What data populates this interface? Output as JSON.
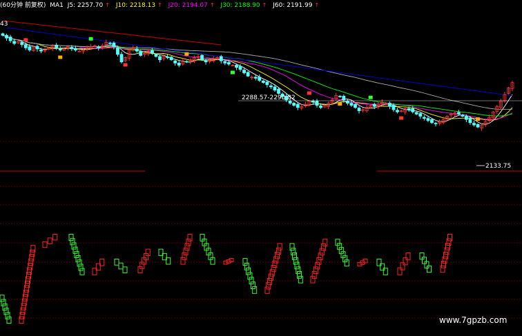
{
  "legend": {
    "period": "(60分钟 前复权)",
    "ma_label": "MA1",
    "items": [
      {
        "key": "J5",
        "label": "J5: 2257.70",
        "arrow": "↑",
        "color": "#ffffff"
      },
      {
        "key": "J10",
        "label": "J10: 2218.13",
        "arrow": "↑",
        "color": "#ffff00"
      },
      {
        "key": "J20",
        "label": "J20: 2194.07",
        "arrow": "↑",
        "color": "#ff00ff"
      },
      {
        "key": "J30",
        "label": "J30: 2188.90",
        "arrow": "↑",
        "color": "#00ff00"
      },
      {
        "key": "J60",
        "label": "J60: 2191.99",
        "arrow": "↑",
        "color": "#ffffff"
      }
    ]
  },
  "colors": {
    "up": "#ff3333",
    "down": "#54ffff",
    "long_red": "#cc0000",
    "long_blue": "#0000cc",
    "gray_ma": "#aaaaaa",
    "grid": "#7a0000",
    "osc_up": "#ff2222",
    "osc_down": "#33ff33",
    "watermark": "#ffffff"
  },
  "annotations": {
    "left_price_fragment": "43",
    "range_label": "2288.57-2290.82",
    "low_label": "2133.75"
  },
  "watermark": "www.7gpzb.com",
  "chart_data": [
    {
      "type": "candlestick",
      "title": "",
      "series_names": [
        "J5",
        "J10",
        "J20",
        "J30",
        "J60"
      ],
      "latest_values": {
        "J5": 2257.7,
        "J10": 2218.13,
        "J20": 2194.07,
        "J30": 2188.9,
        "J60": 2191.99
      },
      "ylim": [
        2105,
        2372
      ],
      "marked_levels": [
        2288.57,
        2290.82,
        2133.75
      ],
      "closes": [
        2345,
        2340,
        2335,
        2330,
        2334,
        2328,
        2322,
        2318,
        2324,
        2320,
        2316,
        2318,
        2322,
        2326,
        2322,
        2318,
        2320,
        2324,
        2320,
        2318,
        2316,
        2318,
        2322,
        2324,
        2326,
        2322,
        2326,
        2332,
        2330,
        2324,
        2310,
        2296,
        2304,
        2318,
        2322,
        2316,
        2308,
        2312,
        2316,
        2312,
        2306,
        2300,
        2306,
        2304,
        2300,
        2294,
        2290,
        2298,
        2296,
        2300,
        2304,
        2306,
        2300,
        2296,
        2300,
        2302,
        2304,
        2298,
        2294,
        2292,
        2290,
        2286,
        2282,
        2276,
        2270,
        2268,
        2266,
        2262,
        2258,
        2254,
        2250,
        2244,
        2238,
        2232,
        2226,
        2220,
        2216,
        2212,
        2214,
        2218,
        2224,
        2222,
        2216,
        2212,
        2216,
        2220,
        2226,
        2234,
        2232,
        2226,
        2220,
        2216,
        2212,
        2206,
        2208,
        2212,
        2216,
        2214,
        2218,
        2222,
        2220,
        2214,
        2208,
        2204,
        2206,
        2210,
        2208,
        2204,
        2200,
        2196,
        2192,
        2188,
        2184,
        2182,
        2186,
        2190,
        2196,
        2200,
        2202,
        2200,
        2196,
        2190,
        2184,
        2180,
        2176,
        2180,
        2186,
        2194,
        2204,
        2214,
        2224,
        2236,
        2248,
        2258
      ],
      "oscillator": {
        "type": "kagi",
        "levels": [
          0.02,
          -0.4,
          0.82,
          1.0,
          0.38,
          0.6,
          0.41,
          0.76,
          0.55,
          1.0,
          0.55,
          0.61,
          0.08,
          0.85,
          0.25,
          0.92,
          0.52,
          0.6,
          0.38,
          0.7,
          0.42,
          1.0
        ],
        "turn_width": [
          15,
          12,
          18,
          22,
          18,
          16,
          18,
          14,
          16,
          12,
          18,
          12,
          16,
          20,
          14,
          20,
          16,
          12,
          14,
          16,
          14,
          12
        ]
      }
    }
  ]
}
